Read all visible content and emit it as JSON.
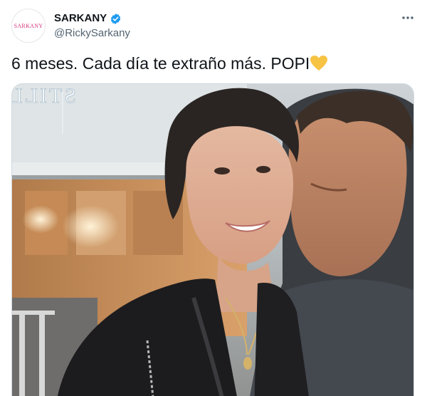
{
  "author": {
    "display_name": "SARKANY",
    "handle": "@RickySarkany",
    "avatar_text": "SARKANY",
    "verified": true,
    "verified_color": "#1d9bf0"
  },
  "tweet": {
    "text": "6 meses. Cada día te extraño más. POPI",
    "emoji": "yellow-heart-icon"
  },
  "media": {
    "sign_text": "STILLS"
  },
  "actions": {
    "more_icon": "more-horizontal-icon",
    "more_label": "···"
  },
  "colors": {
    "text": "#0f1419",
    "muted": "#536471",
    "brand_pink": "#d1337a",
    "heart_yellow": "#f6c343"
  }
}
